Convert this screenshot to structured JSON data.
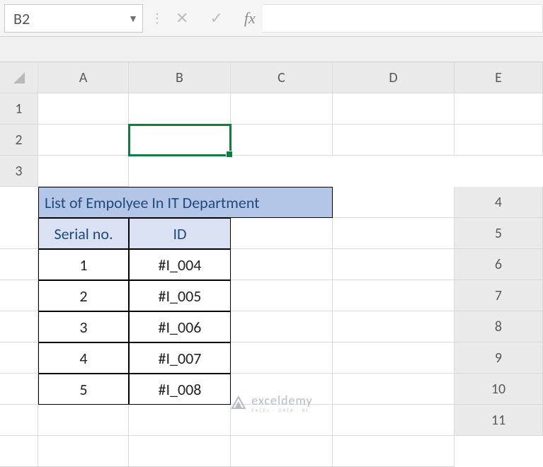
{
  "colors": {
    "accent_green": "#107c41",
    "header_fill": "#d9e1f2",
    "title_fill": "#b4c6e7",
    "header_text": "#1f497d"
  },
  "formula_bar": {
    "name_box": "B2",
    "cancel_glyph": "✕",
    "enter_glyph": "✓",
    "fx_label": "fx",
    "formula_value": ""
  },
  "columns": [
    "A",
    "B",
    "C",
    "D",
    "E"
  ],
  "rows": [
    "1",
    "2",
    "3",
    "4",
    "5",
    "6",
    "7",
    "8",
    "9",
    "10",
    "11"
  ],
  "active_cell": "B2",
  "table": {
    "title": "List of Empolyee In IT Department",
    "headers": {
      "serial": "Serial no.",
      "id": "ID"
    },
    "rows": [
      {
        "serial": "1",
        "id": "#I_004"
      },
      {
        "serial": "2",
        "id": "#I_005"
      },
      {
        "serial": "3",
        "id": "#I_006"
      },
      {
        "serial": "4",
        "id": "#I_007"
      },
      {
        "serial": "5",
        "id": "#I_008"
      }
    ]
  },
  "chart_data": {
    "type": "table",
    "title": "List of Empolyee In IT Department",
    "columns": [
      "Serial no.",
      "ID"
    ],
    "rows": [
      [
        "1",
        "#I_004"
      ],
      [
        "2",
        "#I_005"
      ],
      [
        "3",
        "#I_006"
      ],
      [
        "4",
        "#I_007"
      ],
      [
        "5",
        "#I_008"
      ]
    ]
  },
  "watermark": {
    "brand": "exceldemy",
    "subtitle": "EXCEL · DATA · BI"
  }
}
